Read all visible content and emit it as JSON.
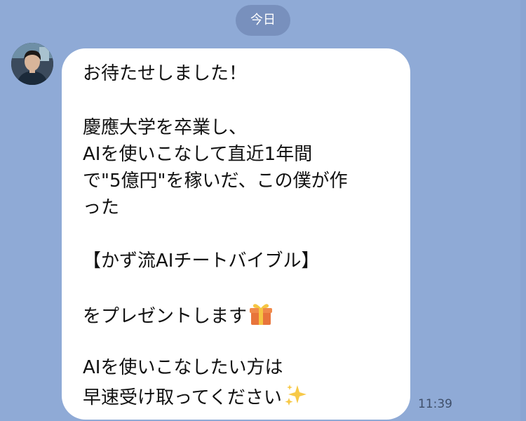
{
  "chat": {
    "date_label": "今日",
    "message": {
      "lines": [
        "お待たせしました！",
        "",
        "慶應大学を卒業し、",
        "AIを使いこなして直近1年間",
        "で\"5億円\"を稼いだ、この僕が作",
        "った",
        "",
        "【かず流AIチートバイブル】",
        "",
        "をプレゼントします",
        "",
        "AIを使いこなしたい方は",
        "早速受け取ってください"
      ],
      "emoji_after_line_10": "gift-icon",
      "emoji_after_line_13": "sparkles-icon",
      "time": "11:39"
    }
  },
  "colors": {
    "background": "#8faad6",
    "bubble": "#ffffff",
    "date_pill": "#7890bd"
  }
}
